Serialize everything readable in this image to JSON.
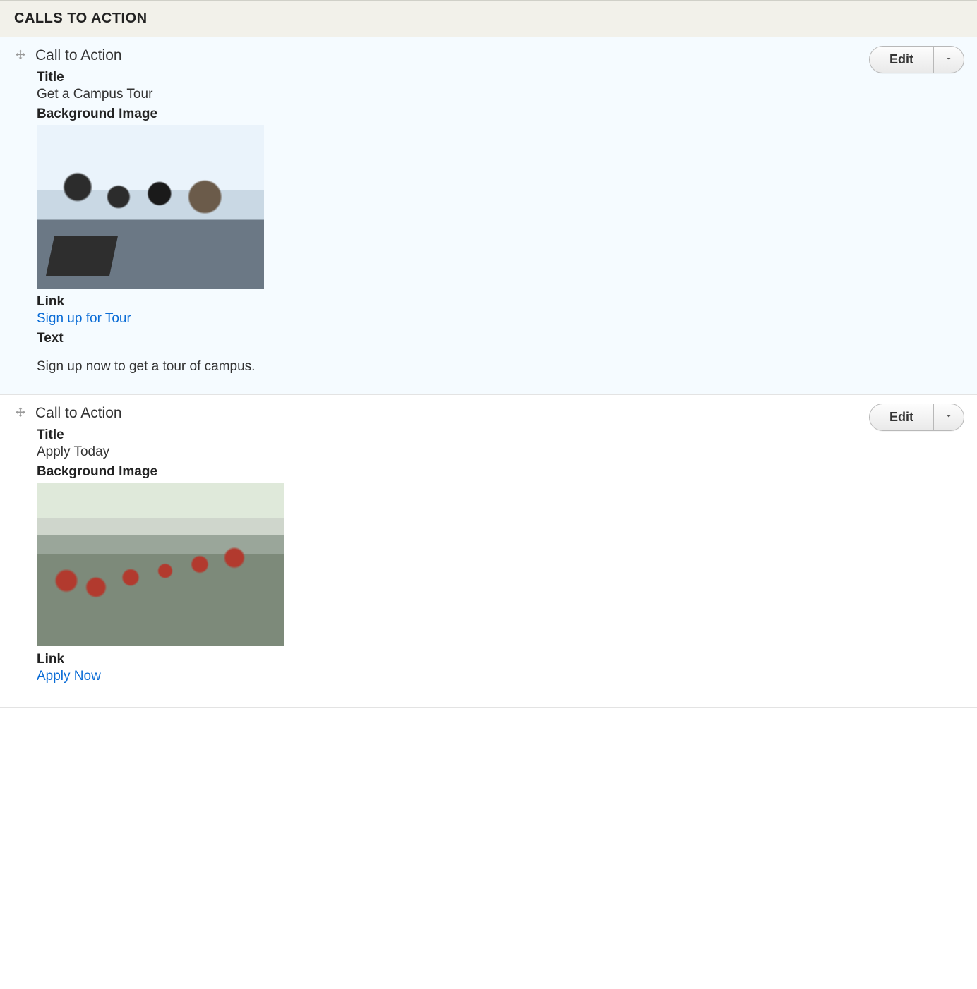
{
  "section": {
    "title": "CALLS TO ACTION"
  },
  "buttons": {
    "edit": "Edit"
  },
  "items": [
    {
      "heading": "Call to Action",
      "fields": {
        "title_label": "Title",
        "title_value": "Get a Campus Tour",
        "bgimage_label": "Background Image",
        "link_label": "Link",
        "link_value": "Sign up for Tour",
        "text_label": "Text",
        "text_value": "Sign up now to get a tour of campus."
      }
    },
    {
      "heading": "Call to Action",
      "fields": {
        "title_label": "Title",
        "title_value": "Apply Today",
        "bgimage_label": "Background Image",
        "link_label": "Link",
        "link_value": "Apply Now"
      }
    }
  ]
}
